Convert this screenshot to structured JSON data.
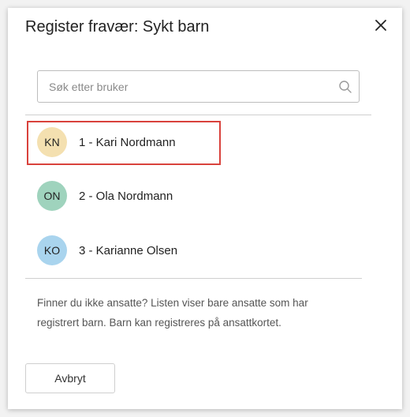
{
  "dialog": {
    "title": "Register fravær: Sykt barn"
  },
  "search": {
    "placeholder": "Søk etter bruker",
    "value": ""
  },
  "users": [
    {
      "initials": "KN",
      "label": "1 - Kari Nordmann",
      "color": "#f4e0b0",
      "selected": true
    },
    {
      "initials": "ON",
      "label": "2 - Ola Nordmann",
      "color": "#9fd3bd",
      "selected": false
    },
    {
      "initials": "KO",
      "label": "3 - Karianne Olsen",
      "color": "#a9d4ee",
      "selected": false
    }
  ],
  "info_text": "Finner du ikke ansatte? Listen viser bare ansatte som har registrert barn. Barn kan registreres på ansattkortet.",
  "buttons": {
    "cancel_label": "Avbryt"
  },
  "colors": {
    "selection_border": "#d9423c",
    "divider": "#cfcfcf"
  },
  "icons": {
    "close": "close-icon",
    "search": "search-icon"
  }
}
